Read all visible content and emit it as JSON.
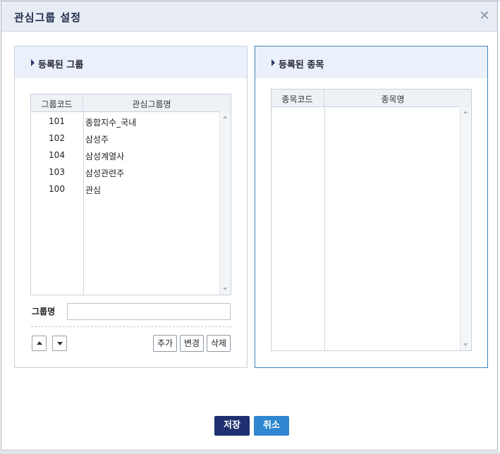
{
  "dialog": {
    "title": "관심그룹 설정",
    "close_icon": "close-icon"
  },
  "left_panel": {
    "title": "등록된 그룹",
    "columns": [
      "그룹코드",
      "관심그룹명"
    ],
    "rows": [
      {
        "code": "101",
        "name": "종합지수_국내"
      },
      {
        "code": "102",
        "name": "삼성주"
      },
      {
        "code": "104",
        "name": "삼성계열사"
      },
      {
        "code": "103",
        "name": "삼성관련주"
      },
      {
        "code": "100",
        "name": "관심"
      }
    ],
    "group_name_label": "그룹명",
    "group_name_value": "",
    "buttons": {
      "move_up_icon": "chevron-up-icon",
      "move_down_icon": "chevron-down-icon",
      "add": "추가",
      "change": "변경",
      "delete": "삭제"
    }
  },
  "right_panel": {
    "title": "등록된 종목",
    "columns": [
      "종목코드",
      "종목명"
    ],
    "rows": []
  },
  "footer": {
    "save": "저장",
    "cancel": "취소"
  },
  "colors": {
    "save_button": "#1f3070",
    "cancel_button": "#2e87cf",
    "active_panel_border": "#3c86c0"
  }
}
